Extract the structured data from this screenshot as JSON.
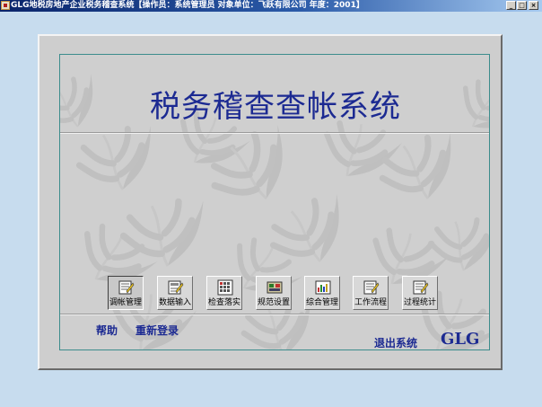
{
  "window": {
    "title": "GLG地税房地产企业税务稽查系统【操作员：系统管理员 对象单位：飞跃有限公司 年度：2001】",
    "min_symbol": "_",
    "max_symbol": "□",
    "close_symbol": "×"
  },
  "header": {
    "system_name": "税务稽查查帐系统"
  },
  "toolbar": {
    "buttons": [
      {
        "label": "调帐管理",
        "icon": "ledger-pen-icon",
        "active": true
      },
      {
        "label": "数据输入",
        "icon": "data-entry-icon"
      },
      {
        "label": "检查落实",
        "icon": "checklist-grid-icon"
      },
      {
        "label": "规范设置",
        "icon": "settings-chip-icon"
      },
      {
        "label": "综合管理",
        "icon": "bar-chart-icon"
      },
      {
        "label": "工作流程",
        "icon": "workflow-pen-icon"
      },
      {
        "label": "过程统计",
        "icon": "statistics-pen-icon"
      }
    ]
  },
  "footer": {
    "help_label": "帮助",
    "relogin_label": "重新登录",
    "exit_label": "退出系统",
    "logo_text": "GLG"
  },
  "colors": {
    "desktop": "#c7dcee",
    "title_bar": "#0a246a",
    "panel": "#cecece",
    "accent_text": "#1c2a92",
    "inner_border": "#3c8c8c"
  }
}
